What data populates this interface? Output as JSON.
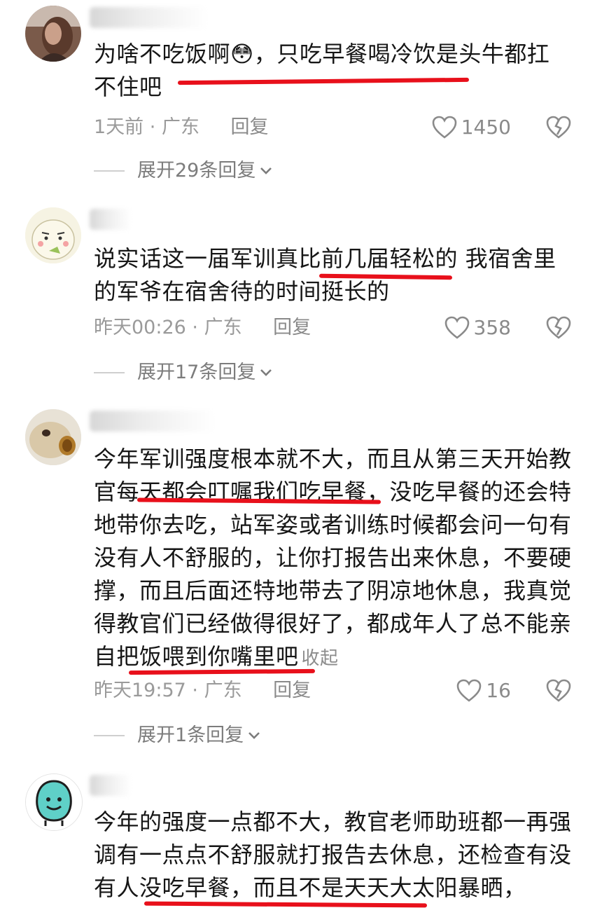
{
  "comments": [
    {
      "lines": [
        "为啥不吃饭啊😳，只吃早餐喝冷饮是头牛都扛",
        "不住吧"
      ],
      "time": "1天前",
      "region": "· 广东",
      "reply_label": "回复",
      "likes": "1450",
      "expand": "展开29条回复"
    },
    {
      "lines": [
        "说实话这一届军训真比前几届轻松的 我宿舍里",
        "的军爷在宿舍待的时间挺长的"
      ],
      "time": "昨天00:26",
      "region": "· 广东",
      "reply_label": "回复",
      "likes": "358",
      "expand": "展开17条回复"
    },
    {
      "lines": [
        "今年军训强度根本就不大，而且从第三天开始教",
        "官每天都会叮嘱我们吃早餐，没吃早餐的还会特",
        "地带你去吃，站军姿或者训练时候都会问一句有",
        "没有人不舒服的，让你打报告出来休息，不要硬",
        "撑，而且后面还特地带去了阴凉地休息，我真觉",
        "得教官们已经做得很好了，都成年人了总不能亲",
        "自把饭喂到你嘴里吧"
      ],
      "collapse": "收起",
      "time": "昨天19:57",
      "region": "· 广东",
      "reply_label": "回复",
      "likes": "16",
      "expand": "展开1条回复"
    },
    {
      "lines": [
        "今年的强度一点都不大，教官老师助班都一再强",
        "调有一点点不舒服就打报告去休息，还检查有没",
        "有人没吃早餐，而且不是天天大太阳暴晒，"
      ]
    }
  ],
  "colors": {
    "highlight": "#e8101b",
    "meta": "#9a9a9a",
    "text": "#161616"
  },
  "icons": [
    "heart-icon",
    "broken-heart-icon",
    "chevron-down-icon"
  ]
}
